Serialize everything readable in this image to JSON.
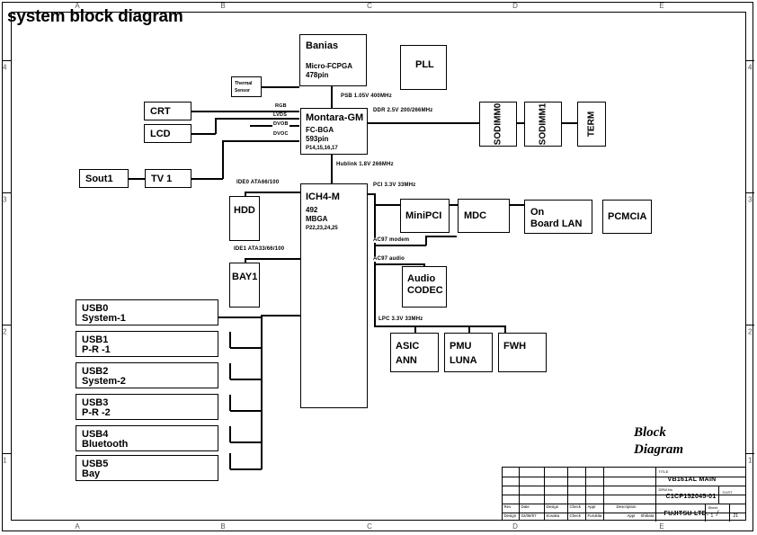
{
  "sheet": {
    "title": "system block diagram",
    "caption_line1": "Block",
    "caption_line2": "Diagram",
    "grid_cols": [
      "A",
      "B",
      "C",
      "D",
      "E"
    ],
    "grid_rows": [
      "4",
      "3",
      "2",
      "1"
    ]
  },
  "blocks": {
    "banias": {
      "name": "Banias",
      "sub1": "Micro-FCPGA",
      "sub2": "478pin"
    },
    "thermal": {
      "line1": "Thermal",
      "line2": "Sensor"
    },
    "pll": {
      "name": "PLL"
    },
    "montara": {
      "name": "Montara-GM",
      "sub1": "FC-BGA",
      "sub2": "593pin",
      "pins": "P14,15,16,17"
    },
    "ich4m": {
      "name": "ICH4-M",
      "sub1": "492",
      "sub2": "MBGA",
      "pins": "P22,23,24,25"
    },
    "crt": {
      "name": "CRT"
    },
    "lcd": {
      "name": "LCD"
    },
    "sout1": {
      "name": "Sout1"
    },
    "tv1": {
      "name": "TV 1"
    },
    "hdd": {
      "name": "HDD"
    },
    "bay1": {
      "name": "BAY1"
    },
    "sodimm0": {
      "name": "SODIMM0"
    },
    "sodimm1": {
      "name": "SODIMM1"
    },
    "term": {
      "name": "TERM"
    },
    "minipci": {
      "name": "MiniPCI"
    },
    "mdc": {
      "name": "MDC"
    },
    "onboardlan": {
      "line1": "On",
      "line2": "Board LAN"
    },
    "pcmcia": {
      "name": "PCMCIA"
    },
    "audiocodec": {
      "line1": "Audio",
      "line2": "CODEC"
    },
    "asic": {
      "line1": "ASIC",
      "line2": "ANN"
    },
    "pmu": {
      "line1": "PMU",
      "line2": "LUNA"
    },
    "fwh": {
      "name": "FWH"
    },
    "usb0": {
      "line1": "USB0",
      "line2": "System-1"
    },
    "usb1": {
      "line1": "USB1",
      "line2": "P-R -1"
    },
    "usb2": {
      "line1": "USB2",
      "line2": "System-2"
    },
    "usb3": {
      "line1": "USB3",
      "line2": "P-R -2"
    },
    "usb4": {
      "line1": "USB4",
      "line2": "Bluetooth"
    },
    "usb5": {
      "line1": "USB5",
      "line2": "Bay"
    }
  },
  "nets": {
    "psb": "PSB 1.05V 400MHz",
    "ddr": "DDR 2.5V 200/266MHz",
    "hublink": "Hublink 1.8V 266MHz",
    "pci": "PCI 3.3V 33MHz",
    "lpc": "LPC 3.3V 33MHz",
    "ac97modem": "AC97 modem",
    "ac97audio": "AC97 audio",
    "ide0": "IDE0 ATA66/100",
    "ide1": "IDE1 ATA33/66/100",
    "rgb": "RGB",
    "lvds": "LVDS",
    "dvob": "DVOB",
    "dvoc": "DVOC"
  },
  "title_block": {
    "title_label": "TITLE",
    "title_value": "VB161AL MAIN",
    "drw_label": "DRW.No",
    "drw_value": "C1CP152045-01",
    "cust_label": "CUST",
    "company": "FUJITSU LTD.",
    "sheet_label": "Sheet",
    "sheet_from": "1",
    "sheet_sep": "/",
    "sheet_to": "21",
    "columns": [
      "Rev",
      "Date",
      "Design",
      "Check",
      "Appr",
      "Description"
    ],
    "row_design_label": "Design",
    "row_date": "02/08/07",
    "row_design_name": "Kosaka",
    "row_check_label": "Check",
    "row_check_name": "Furukita",
    "row_appr_label": "Appr",
    "row_appr_name": "Shibata"
  }
}
